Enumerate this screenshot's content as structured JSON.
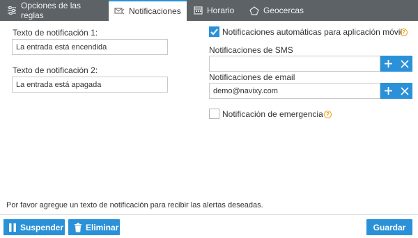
{
  "tabs": [
    {
      "label": "Opciones de las reglas",
      "icon": "sliders-icon",
      "active": false
    },
    {
      "label": "Notificaciones",
      "icon": "notification-icon",
      "active": true
    },
    {
      "label": "Horario",
      "icon": "calendar-icon",
      "active": false
    },
    {
      "label": "Geocercas",
      "icon": "pentagon-icon",
      "active": false
    }
  ],
  "left": {
    "notif1": {
      "label": "Texto de notificación 1:",
      "value": "La entrada está encendida"
    },
    "notif2": {
      "label": "Texto de notificación 2:",
      "value": "La entrada está apagada"
    }
  },
  "right": {
    "auto_mobile": {
      "label": "Notificaciones automáticas para aplicación móvil",
      "checked": true
    },
    "sms": {
      "label": "Notificaciones de SMS",
      "value": ""
    },
    "email": {
      "label": "Notificaciones de email",
      "value": "demo@navixy.com"
    },
    "emergency": {
      "label": "Notificación de emergencia",
      "checked": false
    }
  },
  "hint": "Por favor agregue un texto de notificación para recibir las alertas deseadas.",
  "footer": {
    "suspend_label": "Suspender",
    "delete_label": "Eliminar",
    "save_label": "Guardar"
  },
  "colors": {
    "accent": "#2a91d8",
    "tabbar": "#5d6266",
    "help": "#f0a020"
  }
}
